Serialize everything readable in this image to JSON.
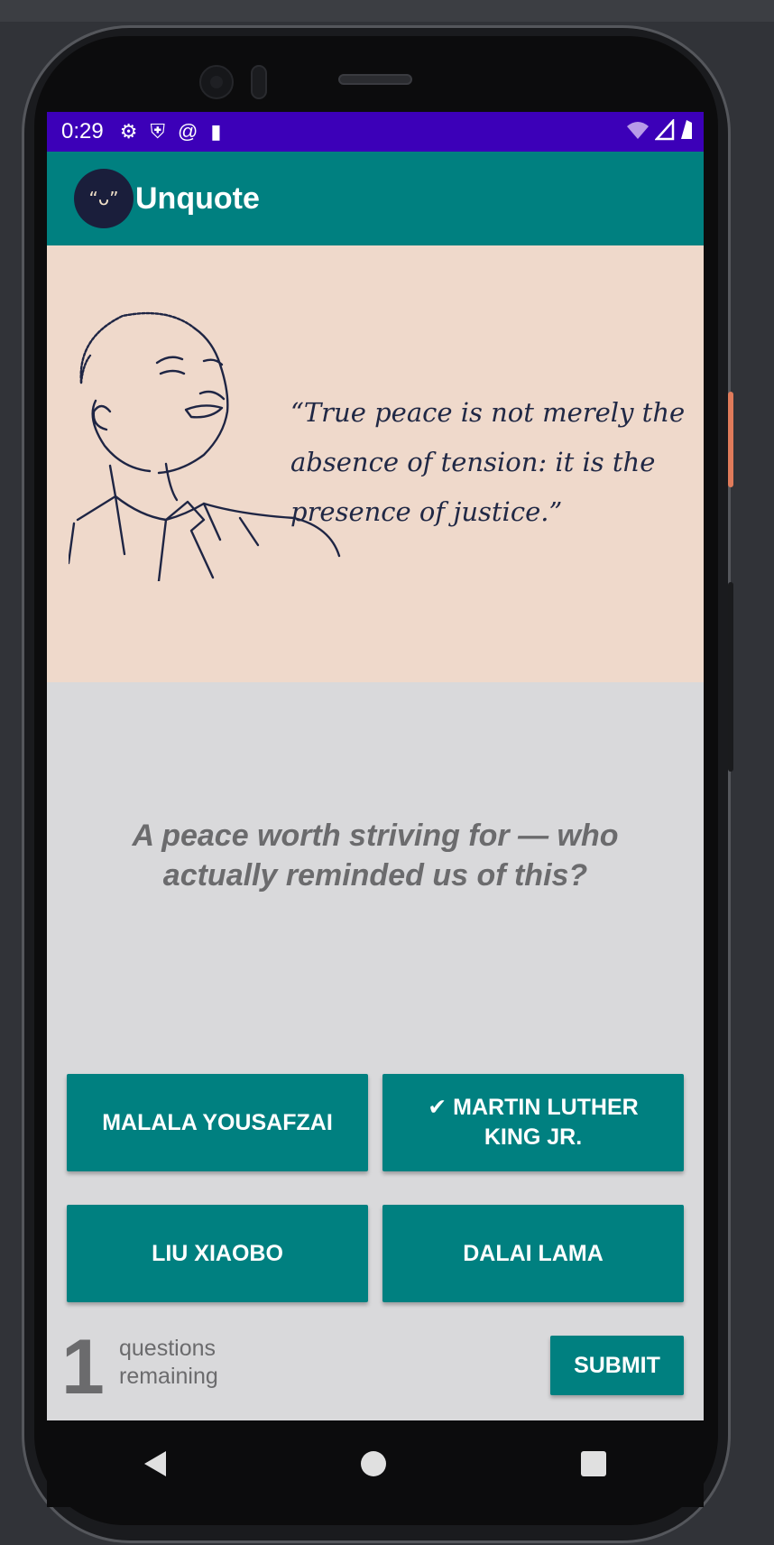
{
  "status_bar": {
    "time": "0:29",
    "left_icons": [
      "gear-icon",
      "shield-icon",
      "at-icon",
      "sd-card-icon"
    ],
    "right_icons": [
      "wifi-icon",
      "signal-icon",
      "battery-icon"
    ]
  },
  "app_bar": {
    "title": "Unquote",
    "logo_text": "“ᴗ”"
  },
  "hero": {
    "quote": "“True peace is not merely the absence of tension: it is the presence of justice.”"
  },
  "question": "A peace worth striving for — who actually reminded us of this?",
  "answers": [
    {
      "label": "MALALA YOUSAFZAI"
    },
    {
      "label": "✔ MARTIN LUTHER KING JR."
    },
    {
      "label": "LIU XIAOBO"
    },
    {
      "label": "DALAI LAMA"
    }
  ],
  "footer": {
    "remaining_count": "1",
    "remaining_label_line1": "questions",
    "remaining_label_line2": "remaining",
    "submit_label": "SUBMIT"
  },
  "colors": {
    "primary": "#008080",
    "status_bar": "#3c00b8",
    "hero_bg": "#efd9cb",
    "content_bg": "#d9d9db"
  }
}
